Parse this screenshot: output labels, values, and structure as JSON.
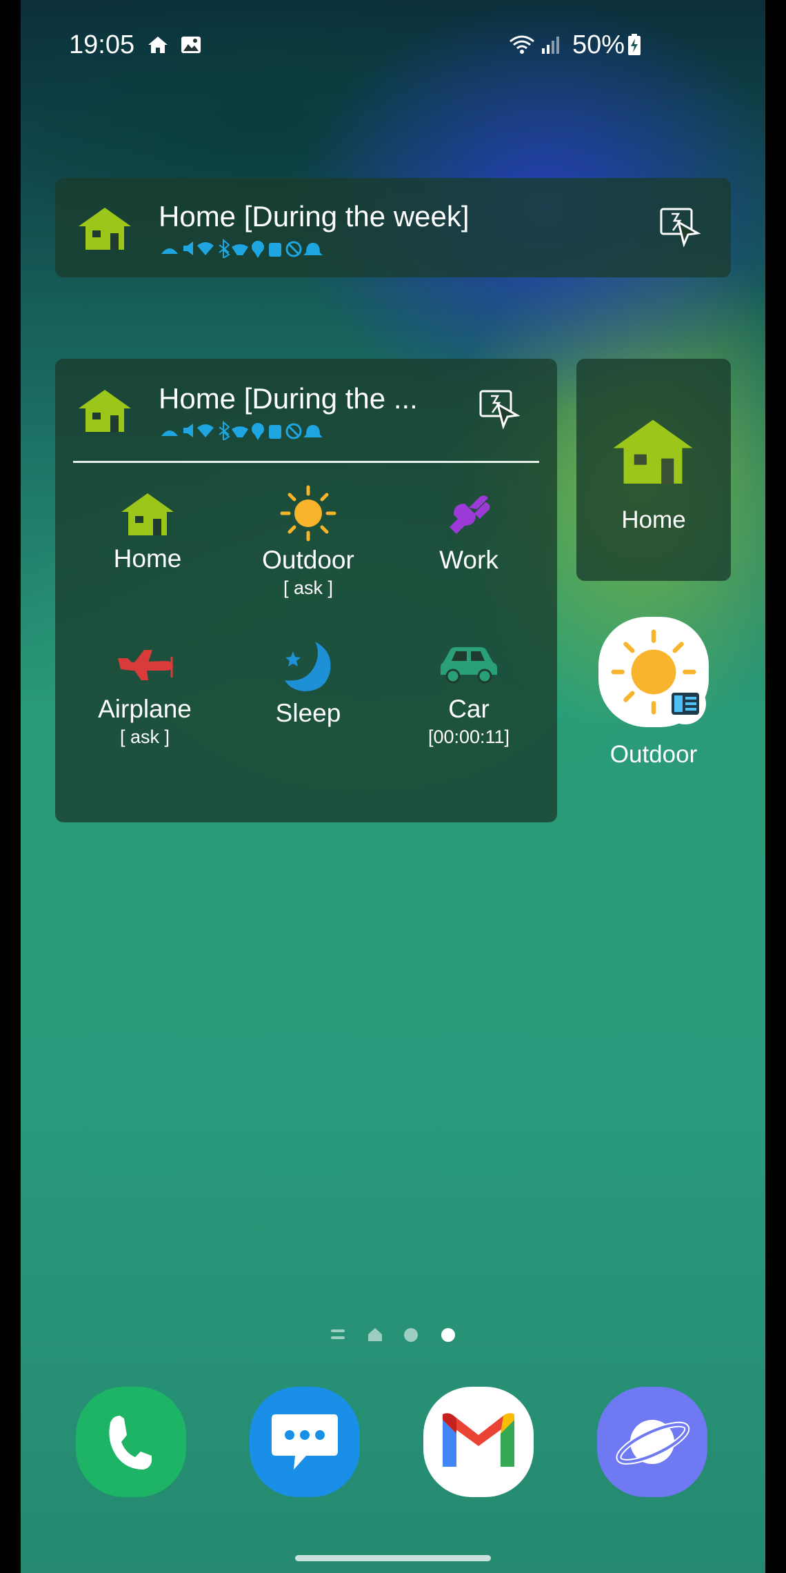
{
  "status_bar": {
    "time": "19:05",
    "battery": "50%"
  },
  "widget_profile_bar": {
    "title": "Home [During the week]"
  },
  "widget_profile_list": {
    "title": "Home [During the ...",
    "items": [
      {
        "label": "Home",
        "sub": "",
        "icon": "home-icon",
        "color": "#9dc61a"
      },
      {
        "label": "Outdoor",
        "sub": "[ ask ]",
        "icon": "sun-icon",
        "color": "#f9b42d"
      },
      {
        "label": "Work",
        "sub": "",
        "icon": "plug-icon",
        "color": "#9b3ad6"
      },
      {
        "label": "Airplane",
        "sub": "[ ask ]",
        "icon": "airplane-icon",
        "color": "#d93a3a"
      },
      {
        "label": "Sleep",
        "sub": "",
        "icon": "moon-icon",
        "color": "#1e90d6"
      },
      {
        "label": "Car",
        "sub": "[00:00:11]",
        "icon": "car-icon",
        "color": "#2aa07a"
      }
    ]
  },
  "widget_single": {
    "label": "Home"
  },
  "shortcut": {
    "label": "Outdoor"
  },
  "dock": [
    {
      "name": "phone-icon",
      "color": "#1db465"
    },
    {
      "name": "messages-icon",
      "color": "#1a8fe8"
    },
    {
      "name": "gmail-icon",
      "color": "#ffffff"
    },
    {
      "name": "internet-icon",
      "color": "#6e79f2"
    }
  ],
  "colors": {
    "accent": "#9dc61a",
    "status_icon": "#1fa6e0"
  }
}
